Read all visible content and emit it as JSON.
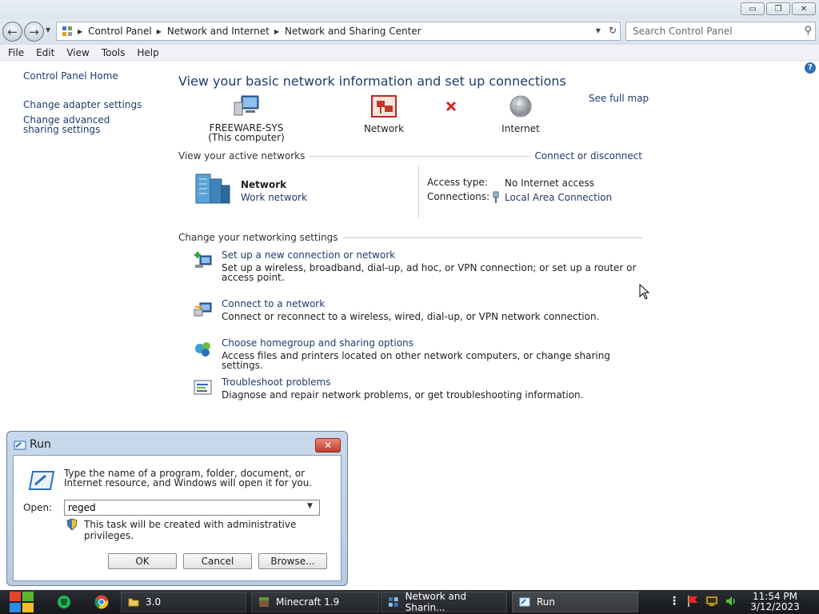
{
  "window": {
    "controls": {
      "minimize": "▭",
      "maximize": "❐",
      "close": "✕"
    }
  },
  "address": {
    "crumbs": [
      "Control Panel",
      "Network and Internet",
      "Network and Sharing Center"
    ],
    "search_placeholder": "Search Control Panel"
  },
  "menu": [
    "File",
    "Edit",
    "View",
    "Tools",
    "Help"
  ],
  "leftnav": {
    "home": "Control Panel Home",
    "links": [
      "Change adapter settings",
      "Change advanced sharing settings"
    ]
  },
  "main": {
    "heading": "View your basic network information and set up connections",
    "see_full_map": "See full map",
    "map": {
      "computer_name": "FREEWARE-SYS",
      "computer_sub": "(This computer)",
      "network_label": "Network",
      "internet_label": "Internet"
    },
    "active": {
      "title": "View your active networks",
      "connect_link": "Connect or disconnect",
      "network_name": "Network",
      "network_type": "Work network",
      "access_label": "Access type:",
      "access_value": "No Internet access",
      "connections_label": "Connections:",
      "connections_value": "Local Area Connection"
    },
    "settings": {
      "title": "Change your networking settings",
      "tasks": [
        {
          "link": "Set up a new connection or network",
          "desc": "Set up a wireless, broadband, dial-up, ad hoc, or VPN connection; or set up a router or access point."
        },
        {
          "link": "Connect to a network",
          "desc": "Connect or reconnect to a wireless, wired, dial-up, or VPN network connection."
        },
        {
          "link": "Choose homegroup and sharing options",
          "desc": "Access files and printers located on other network computers, or change sharing settings."
        },
        {
          "link": "Troubleshoot problems",
          "desc": "Diagnose and repair network problems, or get troubleshooting information."
        }
      ]
    }
  },
  "run": {
    "title": "Run",
    "message": "Type the name of a program, folder, document, or Internet resource, and Windows will open it for you.",
    "open_label": "Open:",
    "open_value": "reged",
    "admin_note": "This task will be created with administrative privileges.",
    "ok": "OK",
    "cancel": "Cancel",
    "browse": "Browse..."
  },
  "taskbar": {
    "items": [
      "3.0",
      "Minecraft 1.9",
      "Network and Sharin...",
      "Run"
    ],
    "time": "11:54 PM",
    "date": "3/12/2023"
  },
  "colors": {
    "link": "#1e3b6e",
    "taskbar": "#1c1e22",
    "accent": "#2f6fb8"
  }
}
